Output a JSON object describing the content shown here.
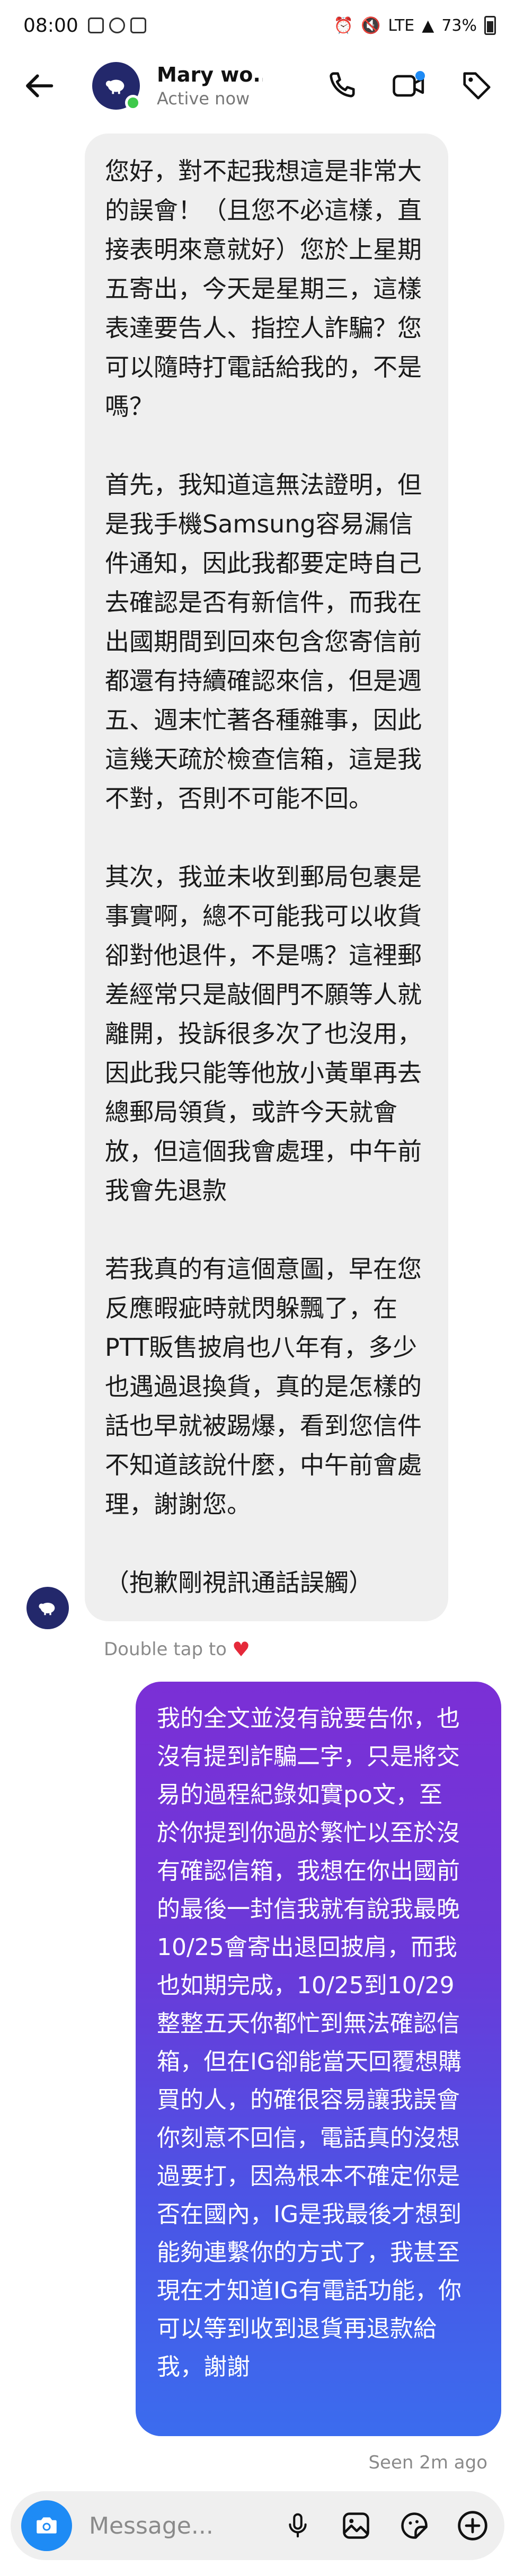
{
  "status_bar": {
    "time": "08:00",
    "battery": "73%",
    "network": "LTE"
  },
  "header": {
    "contact_name": "Mary wo...",
    "presence": "Active now",
    "icons": [
      "back-arrow-icon",
      "phone-icon",
      "video-call-icon",
      "tag-icon"
    ]
  },
  "conversation": {
    "incoming_message": {
      "paragraphs": [
        [
          "您好，對不起我想這是非常大",
          "的誤會！（且您不必這樣，直",
          "接表明來意就好）您於上星期",
          "五寄出，今天是星期三，這樣",
          "表達要告人、指控人詐騙？您",
          "可以隨時打電話給我的，不是",
          "嗎？"
        ],
        [
          "首先，我知道這無法證明，但",
          "是我手機Samsung容易漏信",
          "件通知，因此我都要定時自己",
          "去確認是否有新信件，而我在",
          "出國期間到回來包含您寄信前",
          "都還有持續確認來信，但是週",
          "五、週末忙著各種雜事，因此",
          "這幾天疏於檢查信箱，這是我",
          "不對，否則不可能不回。"
        ],
        [
          "其次，我並未收到郵局包裹是",
          "事實啊，總不可能我可以收貨",
          "卻對他退件，不是嗎？這裡郵",
          "差經常只是敲個門不願等人就",
          "離開，投訴很多次了也沒用，",
          "因此我只能等他放小黃單再去",
          "總郵局領貨，或許今天就會",
          "放，但這個我會處理，中午前",
          "我會先退款"
        ],
        [
          "若我真的有這個意圖，早在您",
          "反應暇疵時就閃躲飄了，在",
          "PTT販售披肩也八年有，多少",
          "也遇過退換貨，真的是怎樣的",
          "話也早就被踢爆，看到您信件",
          "不知道該說什麼，中午前會處",
          "理，謝謝您。"
        ],
        [
          "（抱歉剛視訊通話誤觸）"
        ]
      ],
      "reaction_hint": "Double tap to",
      "reaction_icon": "heart-icon"
    },
    "outgoing_message": {
      "lines": [
        "我的全文並沒有說要告你，也",
        "沒有提到詐騙二字，只是將交",
        "易的過程紀錄如實po文，至",
        "於你提到你過於繁忙以至於沒",
        "有確認信箱，我想在你出國前",
        "的最後一封信我就有說我最晚",
        "10/25會寄出退回披肩，而我",
        "也如期完成，10/25到10/29",
        "整整五天你都忙到無法確認信",
        "箱，但在IG卻能當天回覆想購",
        "買的人，的確很容易讓我誤會",
        "你刻意不回信，電話真的沒想",
        "過要打，因為根本不確定你是",
        "否在國內，IG是我最後才想到",
        "能夠連繫你的方式了，我甚至",
        "現在才知道IG有電話功能，你",
        "可以等到收到退貨再退款給",
        "我，謝謝"
      ],
      "status": "Seen 2m ago"
    }
  },
  "composer": {
    "placeholder": "Message...",
    "icons": [
      "camera-icon",
      "microphone-icon",
      "gallery-icon",
      "sticker-icon",
      "add-icon"
    ]
  },
  "colors": {
    "incoming_bubble": "#efefef",
    "outgoing_gradient_top": "#7b2fd6",
    "outgoing_gradient_bottom": "#3b6cee",
    "accent_blue": "#1e8bf5",
    "online_green": "#3ec94a",
    "heart_red": "#e5293a"
  }
}
